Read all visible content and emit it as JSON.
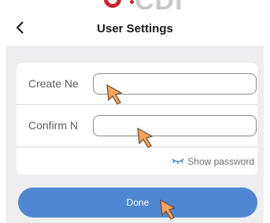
{
  "header": {
    "brand_text": "CDI",
    "title": "User Settings",
    "back_icon": "chevron-left-icon"
  },
  "form": {
    "create_label": "Create Ne",
    "create_value": "",
    "confirm_label": "Confirm N",
    "confirm_value": "",
    "show_password_label": "Show password",
    "show_password_icon": "closed-eye-icon"
  },
  "actions": {
    "done_label": "Done"
  },
  "colors": {
    "accent": "#4f86d1",
    "brand": "#c8262c",
    "cursor": "#f4a460"
  }
}
